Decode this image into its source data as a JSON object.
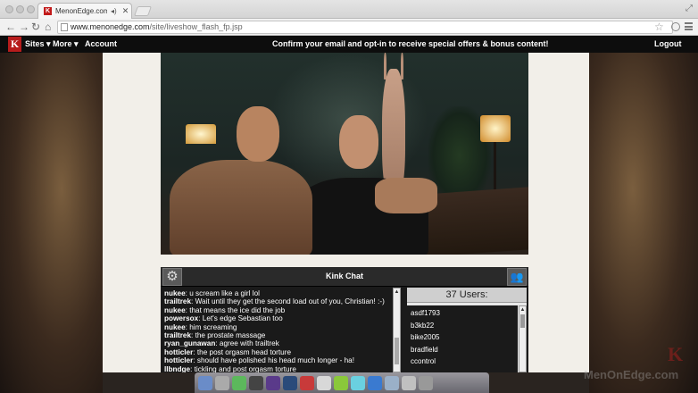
{
  "browser": {
    "tab_title": "MenonEdge.com - Live",
    "tab_favicon": "K",
    "url_host": "www.menonedge.com",
    "url_path": "/site/liveshow_flash_fp.jsp"
  },
  "sitenav": {
    "logo": "K",
    "items": [
      "Sites ▾",
      "More ▾",
      "Account"
    ],
    "promo": "Confirm your email and opt-in to receive special offers & bonus content!",
    "logout": "Logout"
  },
  "chat": {
    "title": "Kink Chat",
    "messages": [
      {
        "user": "nukee",
        "text": ": u scream like a girl  lol"
      },
      {
        "user": "trailtrek",
        "text": ": Wait until they get the second load out of you, Christian!   :-)"
      },
      {
        "user": "nukee",
        "text": ": that means the ice did the job"
      },
      {
        "user": "powersox",
        "text": ": Let's edge Sebastian too"
      },
      {
        "user": "nukee",
        "text": ": him screaming"
      },
      {
        "user": "trailtrek",
        "text": ": the prostate massage"
      },
      {
        "user": "ryan_gunawan",
        "text": ": agree with trailtrek"
      },
      {
        "user": "hotticler",
        "text": ": the post orgasm head torture"
      },
      {
        "user": "hotticler",
        "text": ": should have polished his head much longer - ha!"
      },
      {
        "user": "llbndge",
        "text": ": tickling and post orgasm torture"
      }
    ],
    "users_count": "37 Users:",
    "users": [
      "asdf1793",
      "b3kb22",
      "bike2005",
      "bradfield",
      "ccontrol"
    ]
  },
  "watermark": "MenOnEdge.com",
  "watermark_logo": "K",
  "colors": {
    "accent": "#b71c1c",
    "nav_bg": "#0d0d0d",
    "content_bg": "#f2efe9"
  }
}
